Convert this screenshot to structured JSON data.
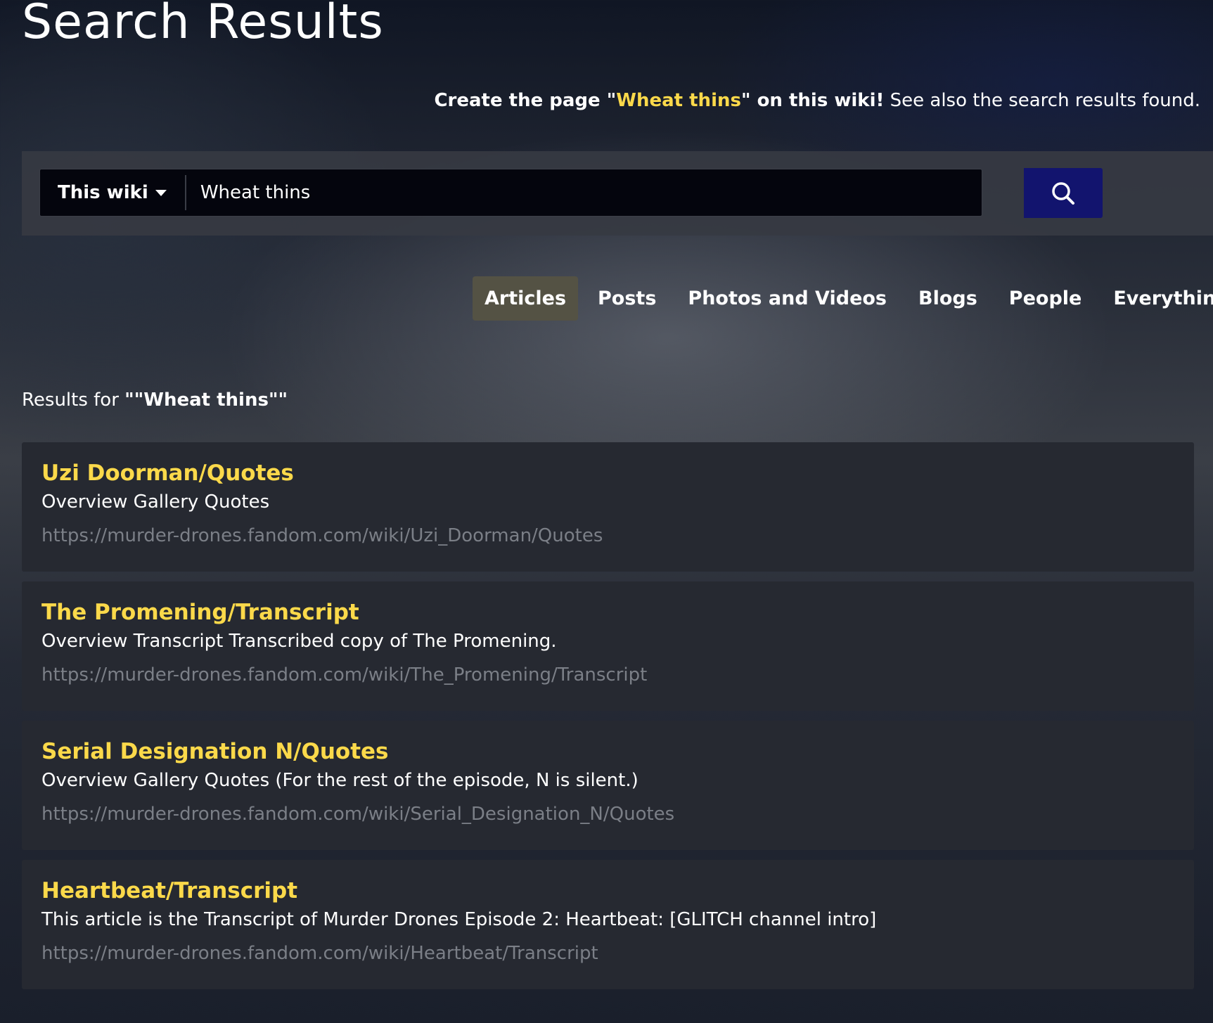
{
  "page": {
    "title": "Search Results"
  },
  "create": {
    "prefix": "Create the page \"",
    "page_name": "Wheat thins",
    "suffix": "\" on this wiki!",
    "see_also": " See also the search results found."
  },
  "search": {
    "scope_label": "This wiki",
    "query": "Wheat thins",
    "scope_icon": "caret-down-icon",
    "button_icon": "search-icon"
  },
  "tabs": [
    {
      "label": "Articles",
      "active": true
    },
    {
      "label": "Posts",
      "active": false
    },
    {
      "label": "Photos and Videos",
      "active": false
    },
    {
      "label": "Blogs",
      "active": false
    },
    {
      "label": "People",
      "active": false
    },
    {
      "label": "Everything",
      "active": false
    }
  ],
  "results_header": {
    "prefix": "Results for ",
    "query_display": "\"\"Wheat thins\"\""
  },
  "results": [
    {
      "title": "Uzi Doorman/Quotes",
      "snippet": "Overview Gallery Quotes",
      "url": "https://murder-drones.fandom.com/wiki/Uzi_Doorman/Quotes"
    },
    {
      "title": "The Promening/Transcript",
      "snippet": "Overview Transcript Transcribed copy of The Promening.",
      "url": "https://murder-drones.fandom.com/wiki/The_Promening/Transcript"
    },
    {
      "title": "Serial Designation N/Quotes",
      "snippet": "Overview Gallery Quotes (For the rest of the episode, N is silent.)",
      "url": "https://murder-drones.fandom.com/wiki/Serial_Designation_N/Quotes"
    },
    {
      "title": "Heartbeat/Transcript",
      "snippet": "This article is the Transcript of Murder Drones Episode 2: Heartbeat: [GLITCH channel intro]",
      "url": "https://murder-drones.fandom.com/wiki/Heartbeat/Transcript"
    }
  ],
  "colors": {
    "accent": "#fbd94a",
    "search_button": "#12146e",
    "card": "#262931",
    "url": "#7b7f87"
  }
}
